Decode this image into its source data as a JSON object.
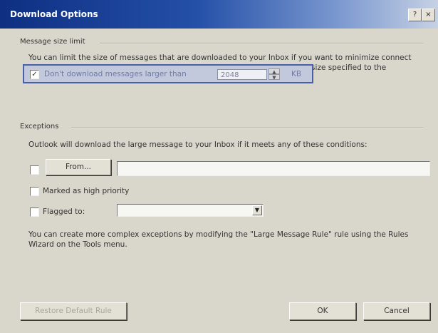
{
  "window": {
    "title": "Download Options",
    "help_icon": "?",
    "close_icon": "×"
  },
  "size_limit": {
    "group_label": "Message size limit",
    "description": "You can limit the size of messages that are downloaded to your Inbox if you want to minimize connect time. Outlook will create a rule that will move all messages larger than the size specified to the designated folder on your server and notify you when it does.",
    "checkbox_checked": true,
    "checkbox_label": "Don't download messages larger than",
    "size_value": "2048",
    "unit": "KB"
  },
  "exceptions": {
    "group_label": "Exceptions",
    "description": "Outlook will download the large message to your Inbox if it meets any of these conditions:",
    "from_button": "From...",
    "from_value": "",
    "high_priority_label": "Marked as high priority",
    "flagged_label": "Flagged to:",
    "flagged_value": "",
    "footer_text": "You can create more complex exceptions by modifying the \"Large Message Rule\" rule using the Rules Wizard on the Tools menu."
  },
  "buttons": {
    "restore_default": "Restore Default Rule",
    "ok": "OK",
    "cancel": "Cancel"
  }
}
